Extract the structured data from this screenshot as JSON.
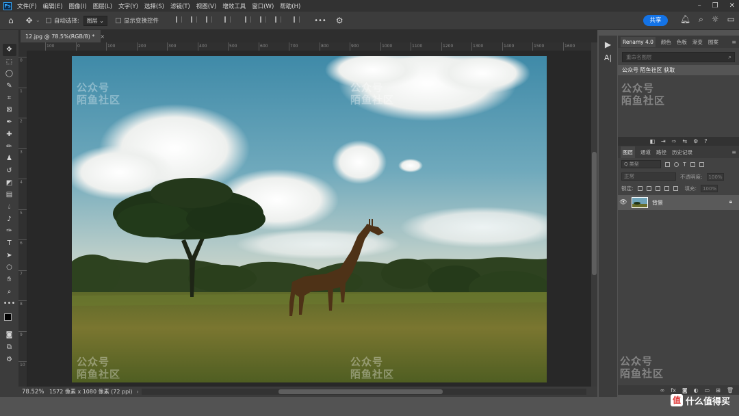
{
  "menubar": {
    "logo": "Ps",
    "items": [
      "文件(F)",
      "编辑(E)",
      "图像(I)",
      "图层(L)",
      "文字(Y)",
      "选择(S)",
      "滤镜(T)",
      "视图(V)",
      "增效工具",
      "窗口(W)",
      "帮助(H)"
    ]
  },
  "options": {
    "auto_select_label": "自动选择:",
    "layer_select": "图层",
    "show_transform_label": "显示变换控件",
    "more_label": "•••",
    "share_label": "共享"
  },
  "document": {
    "tab_title": "12.jpg @ 78.5%(RGB/8) *",
    "zoom": "78.52%",
    "info": "1572 像素 x 1080 像素 (72 ppi)"
  },
  "rulers": {
    "h_ticks": [
      "100",
      "0",
      "100",
      "200",
      "300",
      "400",
      "500",
      "600",
      "700",
      "800",
      "900",
      "1000",
      "1100",
      "1200",
      "1300",
      "1400",
      "1500",
      "1600"
    ],
    "v_ticks": [
      "0",
      "1",
      "2",
      "3",
      "4",
      "5",
      "6",
      "7",
      "8",
      "9",
      "10"
    ]
  },
  "renamy_panel": {
    "tabs": [
      "Renamy 4.0",
      "颜色",
      "色板",
      "渐变",
      "图案"
    ],
    "input_placeholder": "重命名图层",
    "note": "公众号 陌鱼社区 获取"
  },
  "layers_panel": {
    "tabs": [
      "图层",
      "通道",
      "路径",
      "历史记录"
    ],
    "filter_kind": "Q 类型",
    "blend_mode": "正常",
    "opacity_label": "不透明度:",
    "opacity_value": "100%",
    "lock_label": "锁定:",
    "fill_label": "填充:",
    "fill_value": "100%",
    "layer_name": "背景"
  },
  "watermark": {
    "line1": "公众号",
    "line2": "陌鱼社区"
  },
  "site_logo": {
    "badge": "值",
    "label": "什么值得买"
  },
  "colors": {
    "accent": "#1473e6",
    "menubar_bg": "#323232",
    "panel_bg": "#424242"
  }
}
